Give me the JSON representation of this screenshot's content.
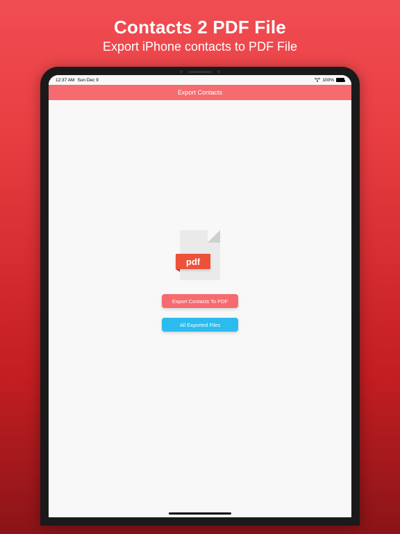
{
  "marketing": {
    "title": "Contacts 2 PDF File",
    "subtitle": "Export iPhone contacts to PDF File"
  },
  "status_bar": {
    "time": "12:37 AM",
    "date": "Sun Dec 9",
    "battery_pct": "100%"
  },
  "nav": {
    "title": "Export Contacts"
  },
  "pdf_icon": {
    "label": "pdf"
  },
  "buttons": {
    "export_label": "Export Contacts To PDF",
    "all_exported_label": "All Exported Files"
  }
}
